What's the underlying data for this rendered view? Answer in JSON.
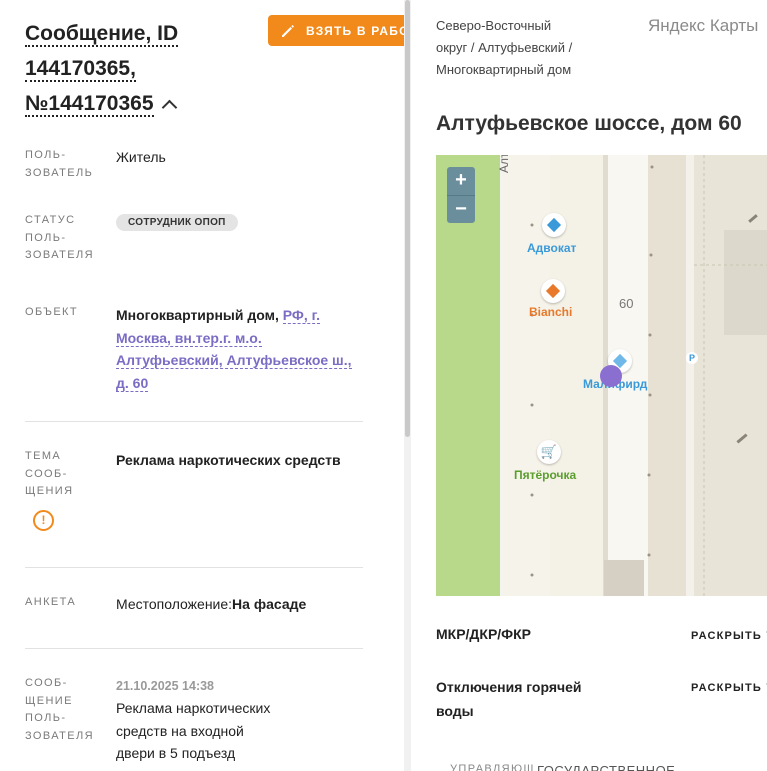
{
  "message": {
    "title_prefix": "Сообщение, ID",
    "id_line": "144170365,",
    "number_line": "№144170365",
    "take_button_label": "ВЗЯТЬ В РАБО"
  },
  "fields": {
    "user_label_1": "ПОЛЬ-",
    "user_label_2": "ЗОВАТЕЛЬ",
    "user_value": "Житель",
    "status_label_1": "СТАТУС",
    "status_label_2": "ПОЛЬ-",
    "status_label_3": "ЗОВАТЕЛЯ",
    "status_badge": "СОТРУДНИК ОПОП",
    "object_label": "ОБЪЕКТ",
    "object_type": "Многоквартирный дом,",
    "object_addr_1": "РФ, г.",
    "object_addr_2": "Москва, вн.тер.г. м.о.",
    "object_addr_3": "Алтуфьевский, Алтуфьевское ш.,",
    "object_addr_4": "д. 60",
    "topic_label_1": "ТЕМА",
    "topic_label_2": "СООБ-",
    "topic_label_3": "ЩЕНИЯ",
    "topic_value": "Реклама наркотических средств",
    "form_label": "АНКЕТА",
    "form_key": "Местоположение:",
    "form_value": "На фасаде",
    "usermsg_label_1": "СООБ-",
    "usermsg_label_2": "ЩЕНИЕ",
    "usermsg_label_3": "ПОЛЬ-",
    "usermsg_label_4": "ЗОВАТЕЛЯ",
    "usermsg_date": "21.10.2025 14:38",
    "usermsg_text_1": "Реклама наркотических",
    "usermsg_text_2": "средств на входной",
    "usermsg_text_3": "двери в 5 подъезд"
  },
  "right": {
    "breadcrumb_1": "Северо-Восточный",
    "breadcrumb_2": "округ / Алтуфьевский /",
    "breadcrumb_3": "Многоквартирный дом",
    "yandex_label": "Яндекс Карты",
    "address_title": "Алтуфьевское шоссе, дом 60",
    "map": {
      "zoom_in": "+",
      "zoom_out": "−",
      "street_label": "Алту",
      "house_number": "60",
      "poi_advokat": "Адвокат",
      "poi_bianchi": "Bianchi",
      "poi_malifird": "Малифирд",
      "poi_pyaterochka": "Пятёрочка"
    },
    "row1_title": "МКР/ДКР/ФКР",
    "row1_btn": "РАСКРЫТЬ",
    "row2_title_1": "Отключения горячей",
    "row2_title_2": "воды",
    "row2_btn": "РАСКРЫТЬ",
    "cut_label": "УПРАВЛЯЮЩ",
    "cut_value": "ГОСУДАРСТВЕННОЕ"
  },
  "colors": {
    "accent_orange": "#f28a1b",
    "link_purple": "#7b6cc4",
    "poi_blue": "#3a9ad9",
    "poi_orange": "#e8792a",
    "poi_green": "#5a9e2e",
    "marker_purple": "#8a6fd1"
  }
}
